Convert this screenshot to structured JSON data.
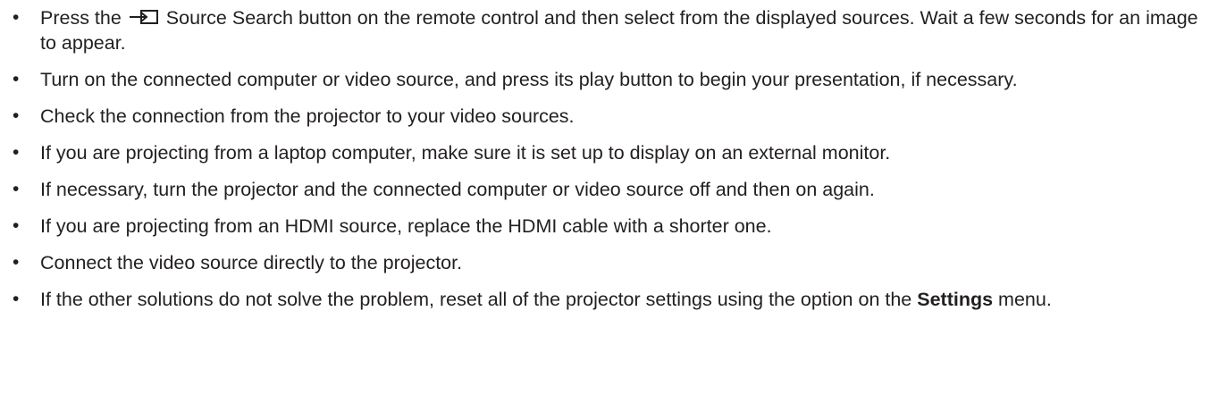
{
  "bullet_char": "•",
  "items": [
    {
      "before_icon": "Press the ",
      "icon": "source-search-icon",
      "after_icon": " Source Search button on the remote control and then select from the displayed sources. Wait a few seconds for an image to appear."
    },
    {
      "text": "Turn on the connected computer or video source, and press its play button to begin your presentation, if necessary."
    },
    {
      "text": "Check the connection from the projector to your video sources."
    },
    {
      "text": "If you are projecting from a laptop computer, make sure it is set up to display on an external monitor."
    },
    {
      "text": "If necessary, turn the projector and the connected computer or video source off and then on again."
    },
    {
      "text": "If you are projecting from an HDMI source, replace the HDMI cable with a shorter one."
    },
    {
      "text": "Connect the video source directly to the projector."
    },
    {
      "text": "If the other solutions do not solve the problem, reset all of the projector settings using the option on the ",
      "bold": "Settings",
      "tail": " menu."
    }
  ]
}
